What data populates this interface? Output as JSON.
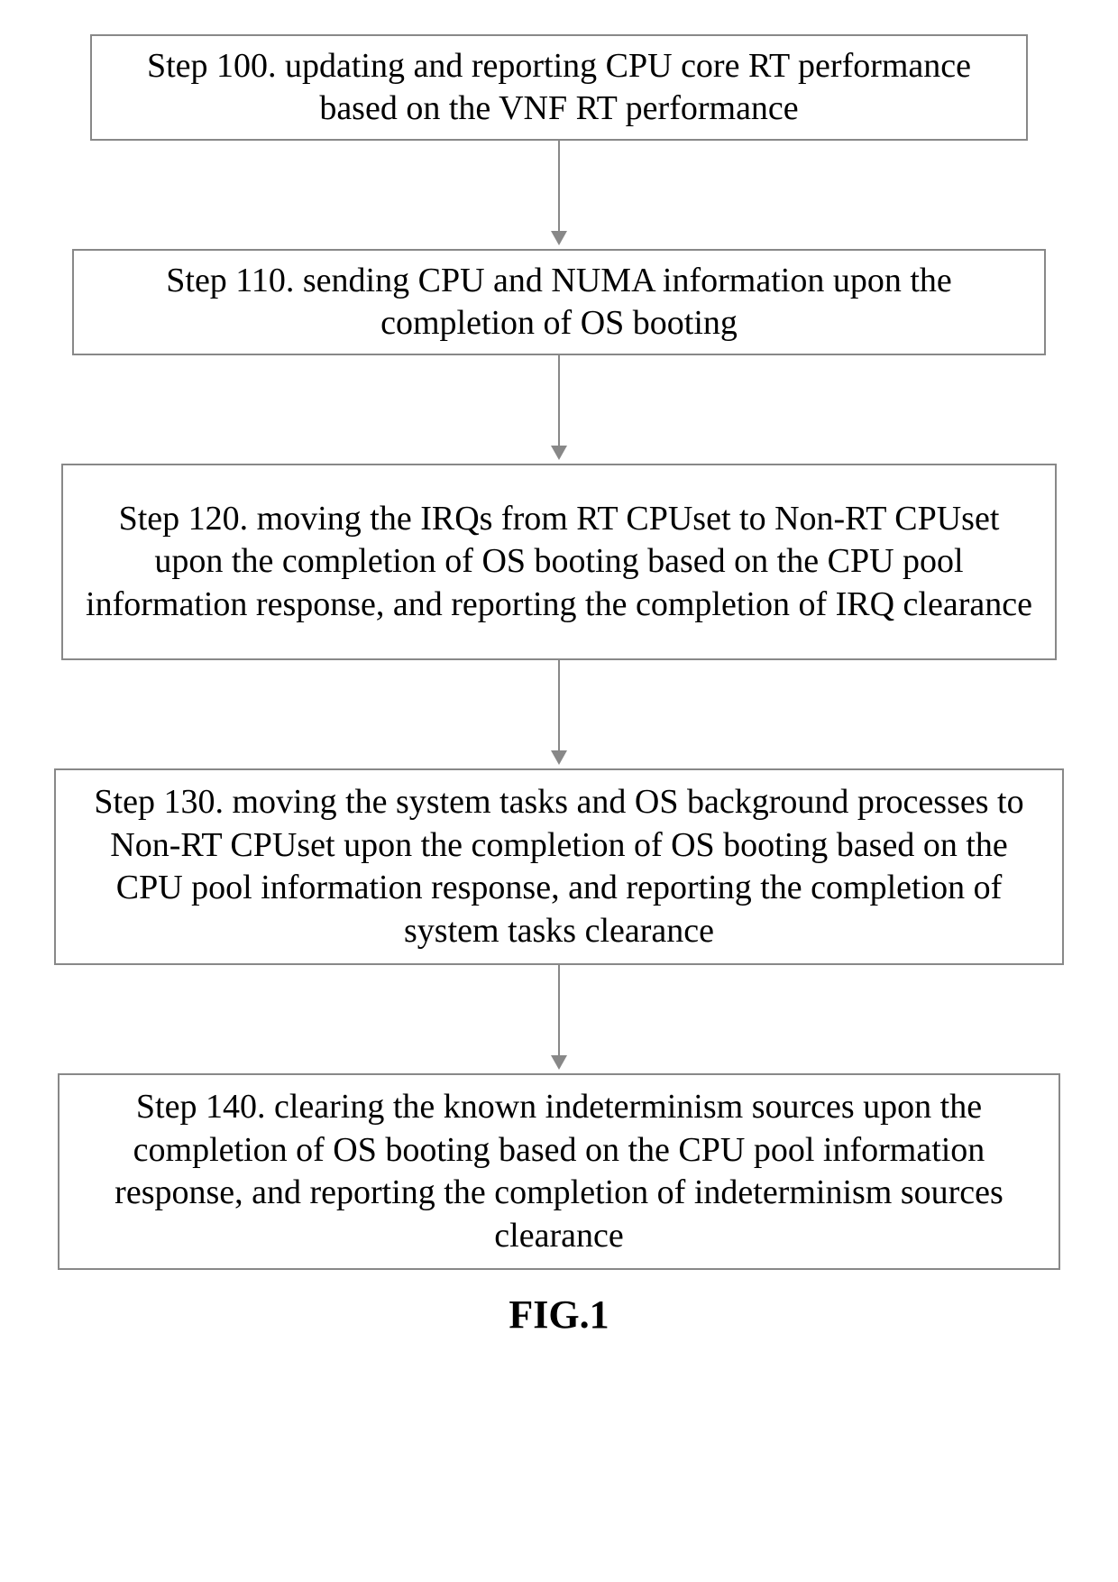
{
  "chart_data": {
    "type": "flowchart",
    "direction": "top-to-bottom",
    "nodes": [
      {
        "id": "s100",
        "label": "Step 100. updating and reporting CPU core RT performance based on the VNF RT performance"
      },
      {
        "id": "s110",
        "label": "Step 110. sending CPU and NUMA information upon the completion of OS booting"
      },
      {
        "id": "s120",
        "label": "Step 120. moving the IRQs from RT CPUset to Non-RT CPUset upon the completion of OS booting based on the CPU pool information response, and reporting the completion of IRQ clearance"
      },
      {
        "id": "s130",
        "label": "Step 130. moving the system tasks and OS background processes to Non-RT CPUset upon the completion of OS booting based on the CPU pool information response, and reporting the completion of system tasks clearance"
      },
      {
        "id": "s140",
        "label": "Step 140. clearing the known indeterminism sources upon the completion of OS booting based on the CPU pool information response, and reporting the completion of indeterminism sources clearance"
      }
    ],
    "edges": [
      {
        "from": "s100",
        "to": "s110"
      },
      {
        "from": "s110",
        "to": "s120"
      },
      {
        "from": "s120",
        "to": "s130"
      },
      {
        "from": "s130",
        "to": "s140"
      }
    ],
    "caption": "FIG.1"
  },
  "steps": {
    "s100": "Step 100. updating and reporting CPU core RT performance based on the VNF RT performance",
    "s110": "Step 110. sending CPU and NUMA information upon the completion of OS booting",
    "s120": "Step 120. moving the IRQs from RT CPUset to Non-RT CPUset upon the completion of OS booting based on the CPU pool information response, and reporting the completion of IRQ clearance",
    "s130": "Step 130. moving the system tasks and OS background processes to Non-RT CPUset upon the completion of OS booting based on the CPU pool information response, and reporting the completion of system tasks clearance",
    "s140": "Step 140. clearing the known indeterminism sources upon the completion of OS booting based on the CPU pool information response, and reporting the completion of indeterminism sources clearance"
  },
  "caption": "FIG.1"
}
